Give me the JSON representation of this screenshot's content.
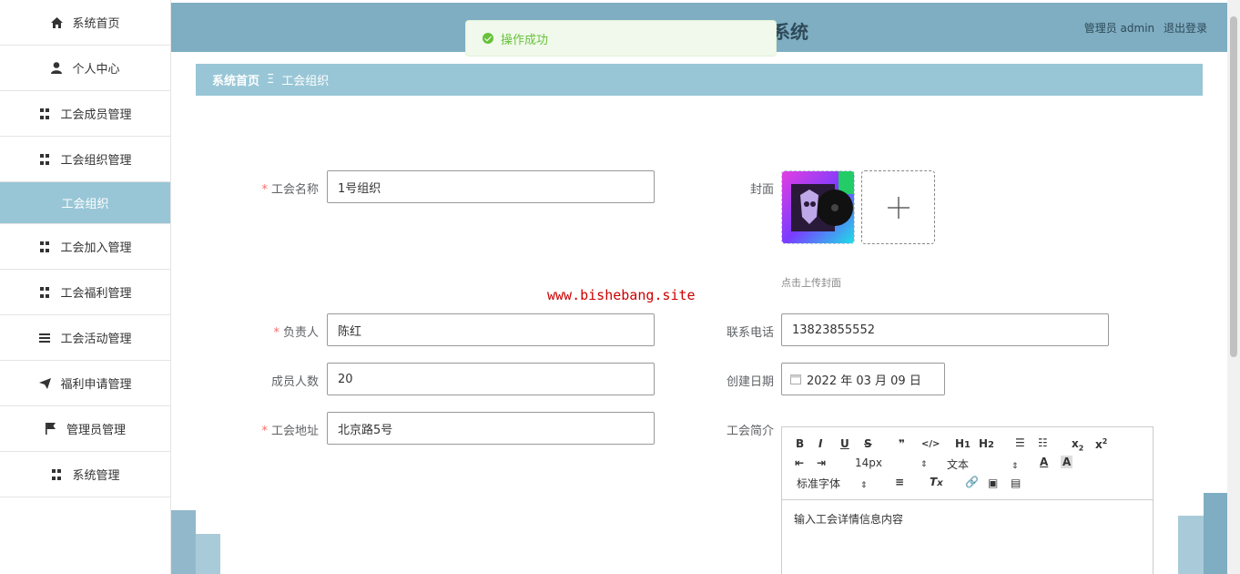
{
  "sidebar": {
    "items": [
      {
        "label": "系统首页",
        "icon": "home-icon"
      },
      {
        "label": "个人中心",
        "icon": "user-icon"
      },
      {
        "label": "工会成员管理",
        "icon": "grid-icon"
      },
      {
        "label": "工会组织管理",
        "icon": "grid-icon"
      },
      {
        "label": "工会组织",
        "icon": "",
        "active": true
      },
      {
        "label": "工会加入管理",
        "icon": "grid-icon"
      },
      {
        "label": "工会福利管理",
        "icon": "grid-icon"
      },
      {
        "label": "工会活动管理",
        "icon": "list-icon"
      },
      {
        "label": "福利申请管理",
        "icon": "send-icon"
      },
      {
        "label": "管理员管理",
        "icon": "flag-icon"
      },
      {
        "label": "系统管理",
        "icon": "grid-icon"
      }
    ]
  },
  "header": {
    "title": "系统",
    "user_label": "管理员 admin",
    "logout_label": "退出登录"
  },
  "toast": {
    "message": "操作成功"
  },
  "breadcrumb": {
    "home": "系统首页",
    "separator": "Ξ",
    "current": "工会组织"
  },
  "form": {
    "name_label": "工会名称",
    "name_value": "1号组织",
    "cover_label": "封面",
    "cover_hint": "点击上传封面",
    "leader_label": "负责人",
    "leader_value": "陈红",
    "phone_label": "联系电话",
    "phone_value": "13823855552",
    "members_label": "成员人数",
    "members_value": "20",
    "date_label": "创建日期",
    "date_value": "2022 年 03 月 09 日",
    "address_label": "工会地址",
    "address_value": "北京路5号",
    "intro_label": "工会简介",
    "intro_placeholder": "输入工会详情信息内容"
  },
  "editor": {
    "font_size": "14px",
    "text_type": "文本",
    "font_family": "标准字体"
  },
  "watermark": "www.bishebang.site",
  "colors": {
    "accent": "#98c6d6",
    "topbar": "#7fadc2",
    "success": "#67c23a",
    "required": "#f56c6c"
  }
}
